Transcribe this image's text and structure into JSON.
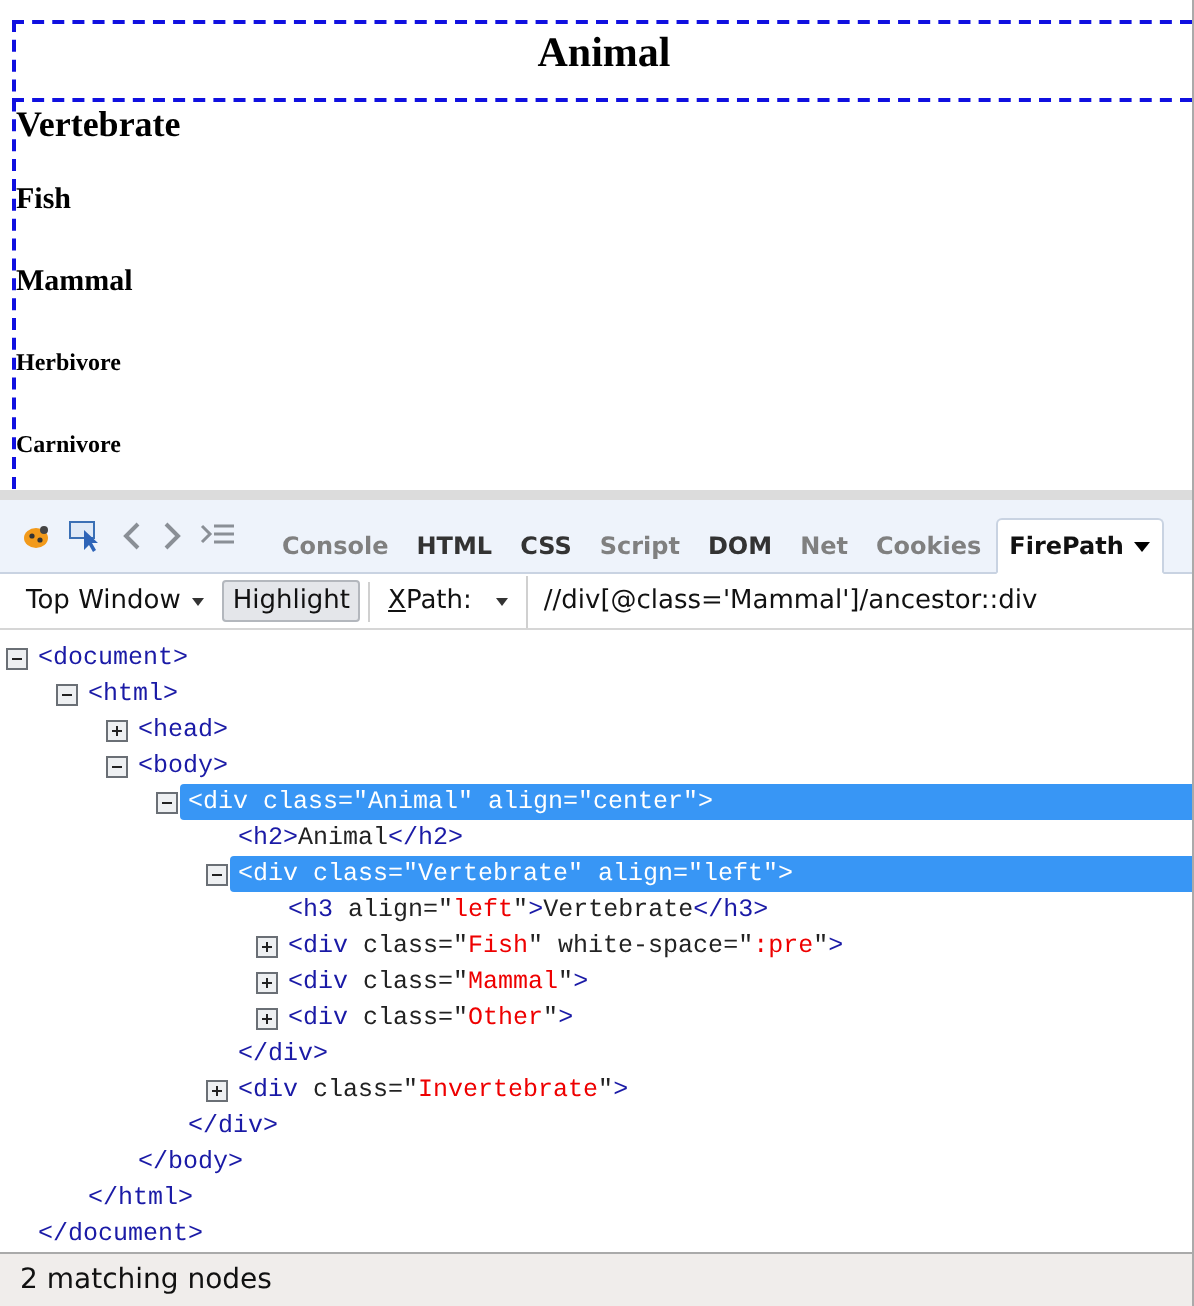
{
  "preview": {
    "outer_div": {
      "highlighted": true,
      "heading": {
        "kind": "h2",
        "text": "Animal"
      }
    },
    "inner_div": {
      "highlighted": true,
      "headings": [
        {
          "kind": "h3",
          "text": "Vertebrate"
        },
        {
          "kind": "h4",
          "text": "Fish"
        },
        {
          "kind": "h4",
          "text": "Mammal"
        },
        {
          "kind": "h5",
          "text": "Herbivore"
        },
        {
          "kind": "h5",
          "text": "Carnivore"
        }
      ]
    }
  },
  "toolbar": {
    "icons": [
      {
        "kind": "bug"
      },
      {
        "kind": "inspect"
      },
      {
        "kind": "back"
      },
      {
        "kind": "forward"
      },
      {
        "kind": "console"
      }
    ],
    "tabs": [
      {
        "label": "Console",
        "selected": false,
        "disabled": true,
        "dropdown": false
      },
      {
        "label": "HTML",
        "selected": false,
        "disabled": false,
        "dropdown": false
      },
      {
        "label": "CSS",
        "selected": false,
        "disabled": false,
        "dropdown": false
      },
      {
        "label": "Script",
        "selected": false,
        "disabled": true,
        "dropdown": false
      },
      {
        "label": "DOM",
        "selected": false,
        "disabled": false,
        "dropdown": false
      },
      {
        "label": "Net",
        "selected": false,
        "disabled": true,
        "dropdown": false
      },
      {
        "label": "Cookies",
        "selected": false,
        "disabled": true,
        "dropdown": false
      },
      {
        "label": "FirePath",
        "selected": true,
        "disabled": false,
        "dropdown": true
      }
    ]
  },
  "firepath_bar": {
    "window_menu": "Top Window",
    "highlight": {
      "label": "Highlight",
      "pressed": true
    },
    "xpath_label": "XPath:",
    "xpath_value": "//div[@class='Mammal']/ancestor::div"
  },
  "tree": [
    {
      "kind": "element",
      "expanded": true,
      "selected": false,
      "tokens": [
        {
          "kind": "tag",
          "s": "<document>"
        }
      ],
      "close": [
        {
          "kind": "tag",
          "s": "</document>"
        }
      ],
      "children": [
        {
          "kind": "element",
          "expanded": true,
          "selected": false,
          "tokens": [
            {
              "kind": "tag",
              "s": "<html>"
            }
          ],
          "close": [
            {
              "kind": "tag",
              "s": "</html>"
            }
          ],
          "children": [
            {
              "kind": "element",
              "expanded": false,
              "selected": false,
              "tokens": [
                {
                  "kind": "tag",
                  "s": "<head>"
                }
              ]
            },
            {
              "kind": "element",
              "expanded": true,
              "selected": false,
              "tokens": [
                {
                  "kind": "tag",
                  "s": "<body>"
                }
              ],
              "close": [
                {
                  "kind": "tag",
                  "s": "</body>"
                }
              ],
              "children": [
                {
                  "kind": "element",
                  "expanded": true,
                  "selected": true,
                  "tokens": [
                    {
                      "s": "<div class=\"Animal\" align=\"center\">"
                    }
                  ],
                  "close": [
                    {
                      "kind": "tag",
                      "s": "</div>"
                    }
                  ],
                  "children": [
                    {
                      "kind": "leaf",
                      "tokens": [
                        {
                          "kind": "tag",
                          "s": "<h2>"
                        },
                        {
                          "kind": "text",
                          "s": "Animal"
                        },
                        {
                          "kind": "tag",
                          "s": "</h2>"
                        }
                      ]
                    },
                    {
                      "kind": "element",
                      "expanded": true,
                      "selected": true,
                      "tokens": [
                        {
                          "s": "<div class=\"Vertebrate\" align=\"left\">"
                        }
                      ],
                      "close": [
                        {
                          "kind": "tag",
                          "s": "</div>"
                        }
                      ],
                      "children": [
                        {
                          "kind": "leaf",
                          "tokens": [
                            {
                              "kind": "tag",
                              "s": "<h3"
                            },
                            {
                              "kind": "attr",
                              "s": " align=\""
                            },
                            {
                              "kind": "value",
                              "s": "left"
                            },
                            {
                              "kind": "attr",
                              "s": "\""
                            },
                            {
                              "kind": "tag",
                              "s": ">"
                            },
                            {
                              "kind": "text",
                              "s": "Vertebrate"
                            },
                            {
                              "kind": "tag",
                              "s": "</h3>"
                            }
                          ]
                        },
                        {
                          "kind": "element",
                          "expanded": false,
                          "selected": false,
                          "tokens": [
                            {
                              "kind": "tag",
                              "s": "<div"
                            },
                            {
                              "kind": "attr",
                              "s": " class=\""
                            },
                            {
                              "kind": "value",
                              "s": "Fish"
                            },
                            {
                              "kind": "attr",
                              "s": "\" white-space=\""
                            },
                            {
                              "kind": "value",
                              "s": ":pre"
                            },
                            {
                              "kind": "attr",
                              "s": "\""
                            },
                            {
                              "kind": "tag",
                              "s": ">"
                            }
                          ]
                        },
                        {
                          "kind": "element",
                          "expanded": false,
                          "selected": false,
                          "tokens": [
                            {
                              "kind": "tag",
                              "s": "<div"
                            },
                            {
                              "kind": "attr",
                              "s": " class=\""
                            },
                            {
                              "kind": "value",
                              "s": "Mammal"
                            },
                            {
                              "kind": "attr",
                              "s": "\""
                            },
                            {
                              "kind": "tag",
                              "s": ">"
                            }
                          ]
                        },
                        {
                          "kind": "element",
                          "expanded": false,
                          "selected": false,
                          "tokens": [
                            {
                              "kind": "tag",
                              "s": "<div"
                            },
                            {
                              "kind": "attr",
                              "s": " class=\""
                            },
                            {
                              "kind": "value",
                              "s": "Other"
                            },
                            {
                              "kind": "attr",
                              "s": "\""
                            },
                            {
                              "kind": "tag",
                              "s": ">"
                            }
                          ]
                        }
                      ]
                    },
                    {
                      "kind": "element",
                      "expanded": false,
                      "selected": false,
                      "tokens": [
                        {
                          "kind": "tag",
                          "s": "<div"
                        },
                        {
                          "kind": "attr",
                          "s": " class=\""
                        },
                        {
                          "kind": "value",
                          "s": "Invertebrate"
                        },
                        {
                          "kind": "attr",
                          "s": "\""
                        },
                        {
                          "kind": "tag",
                          "s": ">"
                        }
                      ]
                    }
                  ]
                }
              ]
            }
          ]
        }
      ]
    }
  ],
  "status_bar": "2 matching nodes"
}
